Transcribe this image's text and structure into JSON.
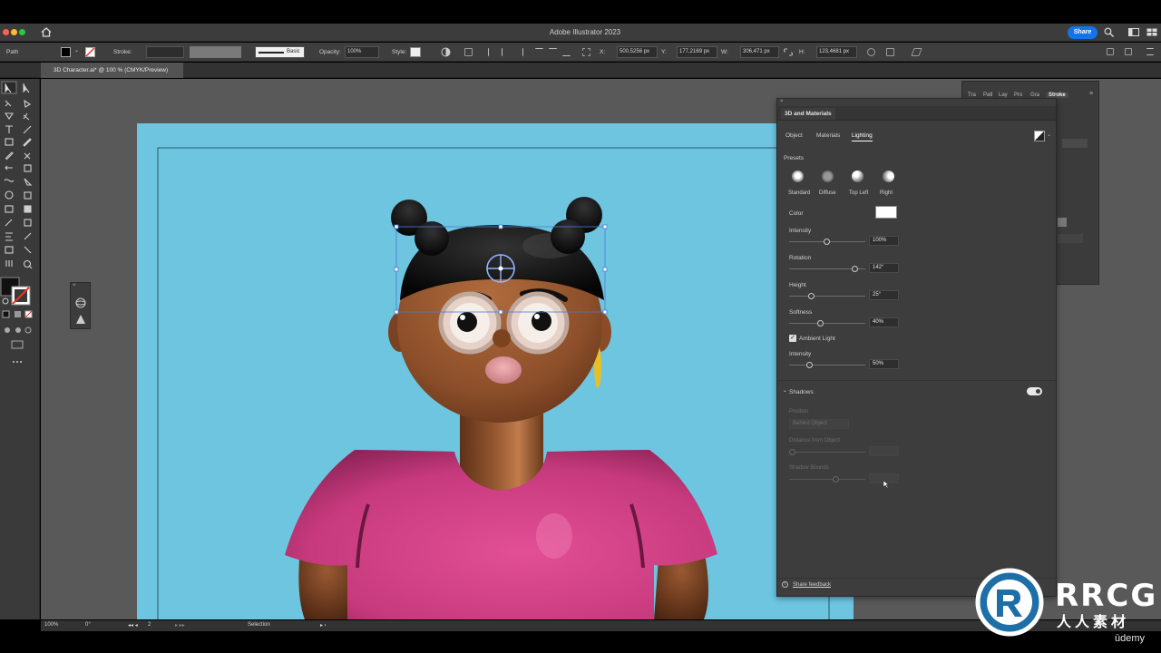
{
  "app_title": "Adobe Illustrator 2023",
  "share_label": "Share",
  "control_bar": {
    "selection_type": "Path",
    "stroke_label": "Stroke:",
    "brush_label": "Basic",
    "opacity_label": "Opacity:",
    "opacity_value": "100%",
    "style_label": "Style:",
    "x_label": "X:",
    "x_value": "500,5256 px",
    "y_label": "Y:",
    "y_value": "177,2169 px",
    "w_label": "W:",
    "w_value": "306,471 px",
    "h_label": "H:",
    "h_value": "123,4681 px"
  },
  "document_tab": "3D Character.ai* @ 100 % (CMYK/Preview)",
  "panel_3d": {
    "title": "3D and Materials",
    "tabs": [
      "Object",
      "Materials",
      "Lighting"
    ],
    "active_tab": "Lighting",
    "presets_label": "Presets",
    "presets": [
      "Standard",
      "Diffuse",
      "Top Left",
      "Right"
    ],
    "color_label": "Color",
    "light_color": "#ffffff",
    "intensity_label": "Intensity",
    "intensity_value": "100%",
    "rotation_label": "Rotation",
    "rotation_value": "142°",
    "height_label": "Height",
    "height_value": "25°",
    "softness_label": "Softness",
    "softness_value": "40%",
    "ambient_label": "Ambient Light",
    "ambient_checked": true,
    "ambient_intensity_label": "Intensity",
    "ambient_intensity_value": "50%",
    "shadows_label": "Shadows",
    "shadows_enabled": true,
    "position_label": "Position",
    "position_value": "Behind Object",
    "distance_label": "Distance from Object",
    "bounds_label": "Shadow Bounds",
    "feedback_label": "Share feedback"
  },
  "background_panel_tabs": [
    "Tra",
    "Patl",
    "Lay",
    "Pro",
    "Gra",
    "Stroke"
  ],
  "status_bar": {
    "zoom": "100%",
    "rotation": "0°",
    "artboard": "2",
    "tool": "Selection"
  },
  "watermark": {
    "brand": "RRCG",
    "sub": "人人素材",
    "platform": "ūdemy"
  },
  "colors": {
    "accent": "#1473e6",
    "artboard_bg": "#6ec5e0",
    "shirt": "#d23f86",
    "skin": "#9a5a33"
  }
}
